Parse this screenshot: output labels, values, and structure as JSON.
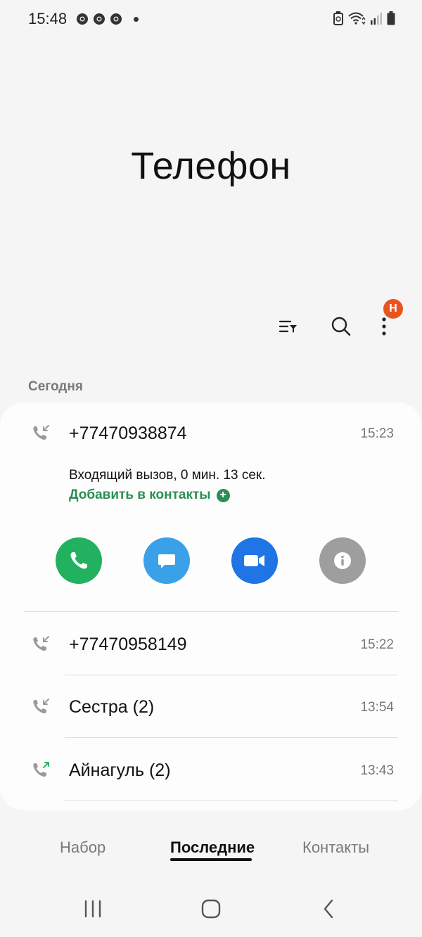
{
  "status_bar": {
    "time": "15:48",
    "icons": [
      "chrome-icon",
      "chrome-icon",
      "chrome-icon",
      "notification-dot",
      "battery-saver-icon",
      "wifi-icon",
      "signal-icon",
      "battery-icon"
    ]
  },
  "header": {
    "title": "Телефон",
    "badge": "Н"
  },
  "toolbar": {
    "icons": [
      "filter-icon",
      "search-icon",
      "more-vert-icon"
    ]
  },
  "section": {
    "label": "Сегодня"
  },
  "calls": [
    {
      "name": "+77470938874",
      "time": "15:23",
      "type": "incoming",
      "details": "Входящий вызов, 0 мин. 13 сек.",
      "add_contact": "Добавить в контакты",
      "actions": [
        "call-icon",
        "message-icon",
        "video-call-icon",
        "info-icon"
      ]
    },
    {
      "name": "+77470958149",
      "time": "15:22",
      "type": "incoming"
    },
    {
      "name": "Сестра (2)",
      "time": "13:54",
      "type": "incoming"
    },
    {
      "name": "Айнагуль (2)",
      "time": "13:43",
      "type": "outgoing"
    }
  ],
  "colors": {
    "call": "#21b15f",
    "message": "#3aa1e8",
    "video": "#1f74e6",
    "info": "#9e9e9e",
    "badge": "#e8531f",
    "add_contact": "#2a8f54",
    "outgoing_arrow": "#2bb36a"
  },
  "tabs": [
    {
      "label": "Набор",
      "active": false
    },
    {
      "label": "Последние",
      "active": true
    },
    {
      "label": "Контакты",
      "active": false
    }
  ],
  "navbar": {
    "icons": [
      "recents-icon",
      "home-icon",
      "back-icon"
    ]
  }
}
